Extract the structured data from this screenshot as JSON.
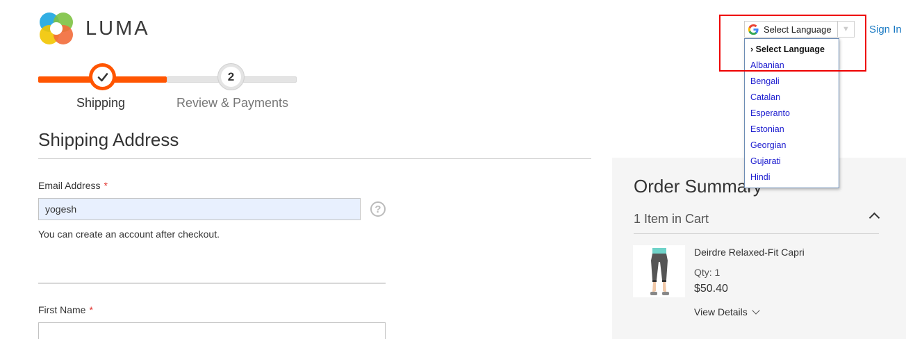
{
  "brand": {
    "name": "LUMA"
  },
  "checkout_steps": [
    {
      "number": "",
      "label": "Shipping",
      "state": "complete"
    },
    {
      "number": "2",
      "label": "Review & Payments",
      "state": "pending"
    }
  ],
  "shipping": {
    "title": "Shipping Address",
    "email": {
      "label": "Email Address",
      "required_mark": "*",
      "value": "yogesh",
      "help_icon": "?",
      "note": "You can create an account after checkout."
    },
    "first_name": {
      "label": "First Name",
      "required_mark": "*",
      "value": ""
    }
  },
  "order_summary": {
    "title": "Order Summary",
    "items_in_cart": "1 Item in Cart",
    "item": {
      "name": "Deirdre Relaxed-Fit Capri",
      "qty": "Qty: 1",
      "price": "$50.40",
      "details_link": "View Details"
    }
  },
  "header": {
    "sign_in": "Sign In"
  },
  "language": {
    "select_label": "Select Language",
    "dropdown_arrow": "▼",
    "dropdown_header": "› Select Language",
    "options": [
      "Albanian",
      "Bengali",
      "Catalan",
      "Esperanto",
      "Estonian",
      "Georgian",
      "Gujarati",
      "Hindi"
    ]
  },
  "colors": {
    "accent": "#ff5501",
    "link": "#1979c3",
    "highlight": "#ee0000"
  }
}
